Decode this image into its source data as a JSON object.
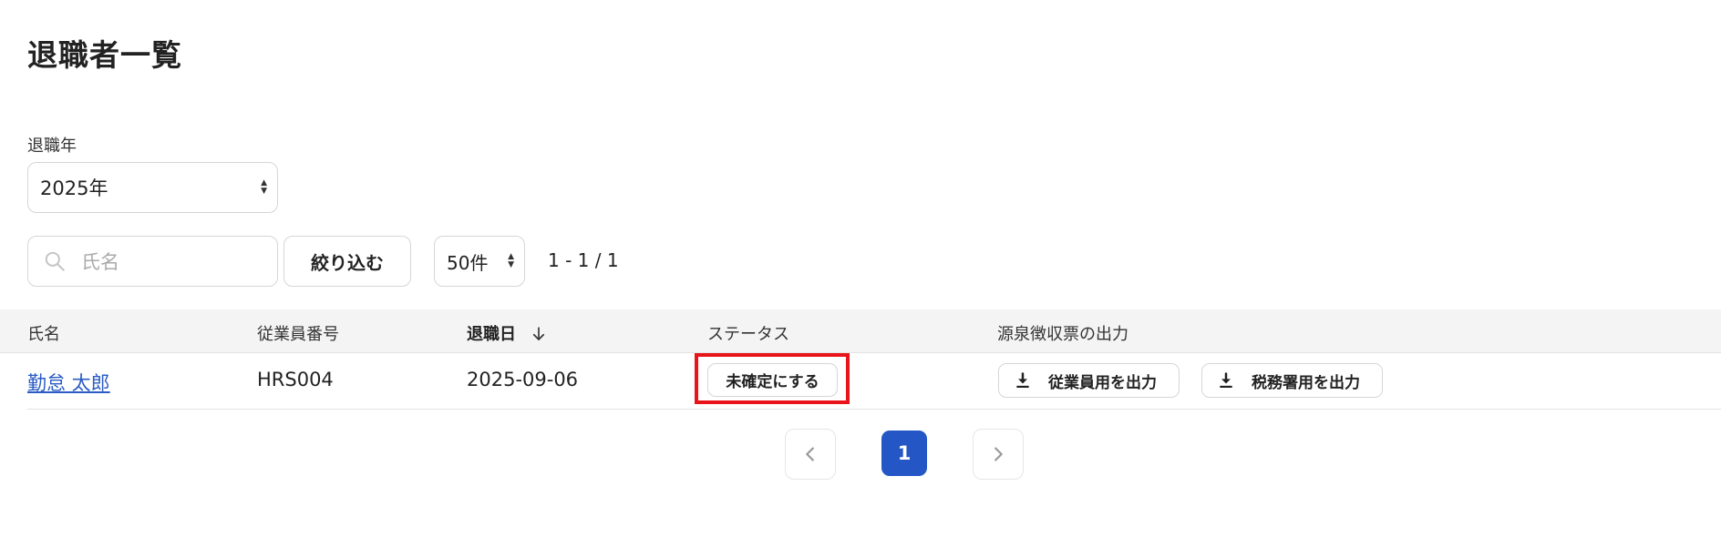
{
  "page": {
    "title": "退職者一覧"
  },
  "filters": {
    "year_label": "退職年",
    "year_value": "2025年",
    "search_placeholder": "氏名",
    "filter_button": "絞り込む",
    "per_page": "50件",
    "range": "1 - 1 / 1"
  },
  "table": {
    "headers": {
      "name": "氏名",
      "employee_number": "従業員番号",
      "retirement_date": "退職日",
      "status": "ステータス",
      "withholding_export": "源泉徴収票の出力"
    },
    "sort": {
      "column": "retirement_date",
      "direction": "descending"
    },
    "rows": [
      {
        "name": "勤怠 太郎",
        "employee_number": "HRS004",
        "retirement_date": "2025-09-06",
        "status_action": "未確定にする",
        "export_employee": "従業員用を出力",
        "export_tax_office": "税務署用を出力"
      }
    ]
  },
  "pagination": {
    "current": "1"
  },
  "colors": {
    "accent": "#2457c5",
    "link": "#2b5bc4",
    "highlight": "#e8141a",
    "header_bg": "#f5f4f4"
  },
  "icons": [
    "search-icon",
    "sort-down-arrow-icon",
    "download-icon",
    "chevron-left-icon",
    "chevron-right-icon",
    "select-arrows-icon"
  ]
}
